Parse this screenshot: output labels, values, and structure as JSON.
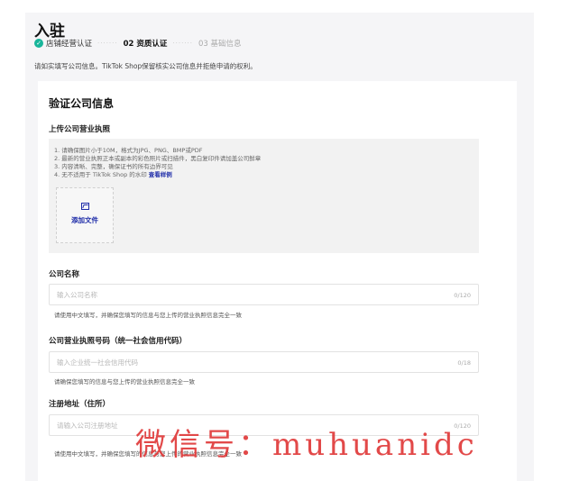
{
  "page": {
    "title": "入驻"
  },
  "steps": [
    {
      "label": "店铺经营认证",
      "state": "done"
    },
    {
      "label": "02 资质认证",
      "state": "active"
    },
    {
      "label": "03 基础信息",
      "state": "pending"
    }
  ],
  "step_separator": "·······",
  "notice": "请如实填写公司信息。TikTok Shop保留核实公司信息并拒绝申请的权利。",
  "form": {
    "title": "验证公司信息",
    "license_upload": {
      "label": "上传公司营业执照",
      "requirements": [
        "1. 请确保图片小于10M，格式为JPG、PNG、BMP或PDF",
        "2. 最新的营业执照正本或副本的彩色照片或扫描件，黑白复印件请加盖公司鲜章",
        "3. 内容清晰、完整，确保证书的所有边界可见",
        "4. 无不适用于 TikTok Shop 的水印"
      ],
      "example_link": "查看样例",
      "add_file_label": "添加文件"
    },
    "company_name": {
      "label": "公司名称",
      "placeholder": "输入公司名称",
      "value": "",
      "counter": "0/120",
      "hint": "请使用中文填写，并确保您填写的信息与您上传的营业执照信息完全一致"
    },
    "license_number": {
      "label": "公司营业执照号码（统一社会信用代码）",
      "placeholder": "输入企业统一社会信用代码",
      "value": "",
      "counter": "0/18",
      "hint": "请确保您填写的信息与您上传的营业执照信息完全一致"
    },
    "registered_address": {
      "label": "注册地址（住所）",
      "placeholder": "请输入公司注册地址",
      "value": "",
      "counter": "0/120",
      "hint": "请使用中文填写，并确保您填写的信息与您上传的营业执照信息完全一致"
    }
  },
  "watermark": "微信号：muhuanidc",
  "colors": {
    "accent": "#1d2ba8",
    "success": "#18b59a",
    "watermark": "#e03a3a"
  }
}
